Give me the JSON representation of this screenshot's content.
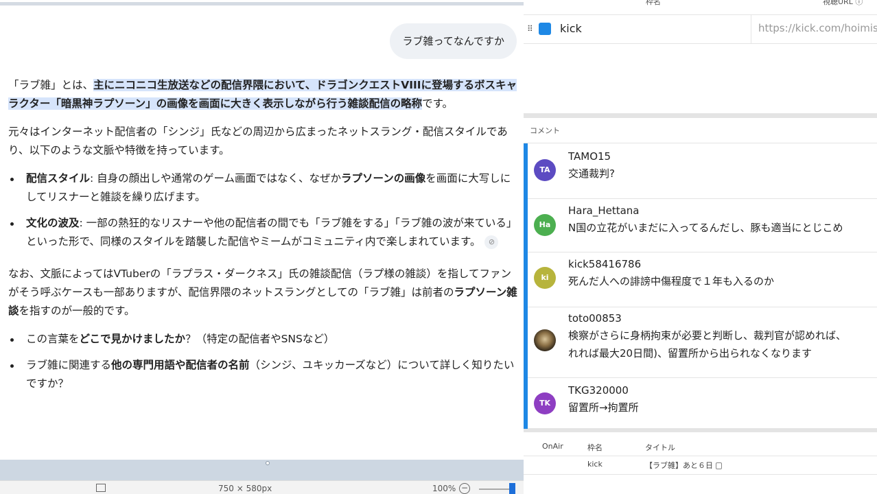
{
  "chat": {
    "user_message": "ラブ雑ってなんですか",
    "p1_pre": "「ラブ雑」とは、",
    "p1_hl": "主にニコニコ生放送などの配信界隈において、ドラゴンクエストVIIIに登場するボスキャラクター「暗黒神ラプソーン」の画像を画面に大きく表示しながら行う雑談配信の略称",
    "p1_post": "です。",
    "p2": "元々はインターネット配信者の「シンジ」氏などの周辺から広まったネットスラング・配信スタイルであり、以下のような文脈や特徴を持っています。",
    "b1_label": "配信スタイル",
    "b1_text1": ": 自身の顔出しや通常のゲーム画面ではなく、なぜか",
    "b1_bold": "ラプソーンの画像",
    "b1_text2": "を画面に大写しにしてリスナーと雑談を繰り広げます。",
    "b2_label": "文化の波及",
    "b2_text": ": 一部の熱狂的なリスナーや他の配信者の間でも「ラブ雑をする」「ラブ雑の波が来ている」といった形で、同様のスタイルを踏襲した配信やミームがコミュニティ内で楽しまれています。",
    "p3_1": "なお、文脈によってはVTuberの「ラプラス・ダークネス」氏の雑談配信（ラプ様の雑談）を指してファンがそう呼ぶケースも一部ありますが、配信界隈のネットスラングとしての「ラブ雑」は前者の",
    "p3_bold": "ラプソーン雑談",
    "p3_2": "を指すのが一般的です。",
    "q1_pre": "この言葉を",
    "q1_bold": "どこで見かけましたか",
    "q1_post": "？（特定の配信者やSNSなど）",
    "q2_pre": "ラブ雑に関連する",
    "q2_bold": "他の専門用語や配信者の名前",
    "q2_post": "（シンジ、ユキッカーズなど）について詳しく知りたいですか？"
  },
  "statusbar": {
    "size": "750 × 580px",
    "zoom": "100%",
    "minus": "−"
  },
  "right": {
    "headers": {
      "frame_name": "枠名",
      "watch_url": "視聴URL ⓘ"
    },
    "stream": {
      "name": "kick",
      "url": "https://kick.com/hoimis"
    },
    "comments_title": "コメント",
    "comments": [
      {
        "initials": "TA",
        "user": "TAMO15",
        "msg": "交通裁判?",
        "color": "#5c4bc2"
      },
      {
        "initials": "Ha",
        "user": "Hara_Hettana",
        "msg": "N国の立花がいまだに入ってるんだし、豚も適当にとじこめ",
        "color": "#4caf50"
      },
      {
        "initials": "ki",
        "user": "kick58416786",
        "msg": "死んだ人への誹謗中傷程度で１年も入るのか",
        "color": "#b7b43c"
      },
      {
        "initials": "",
        "user": "toto00853",
        "msg": "検察がさらに身柄拘束が必要と判断し、裁判官が認めれば、",
        "msg2": "れれば最大20日間)、留置所から出られなくなります",
        "color": "#4a3b2a"
      },
      {
        "initials": "TK",
        "user": "TKG320000",
        "msg": "留置所→拘置所",
        "color": "#8e3ec2"
      }
    ],
    "table": {
      "col_onair": "OnAir",
      "col_name": "枠名",
      "col_title": "タイトル",
      "row_name": "kick",
      "row_title": "【ラブ雑】あと６日"
    }
  }
}
